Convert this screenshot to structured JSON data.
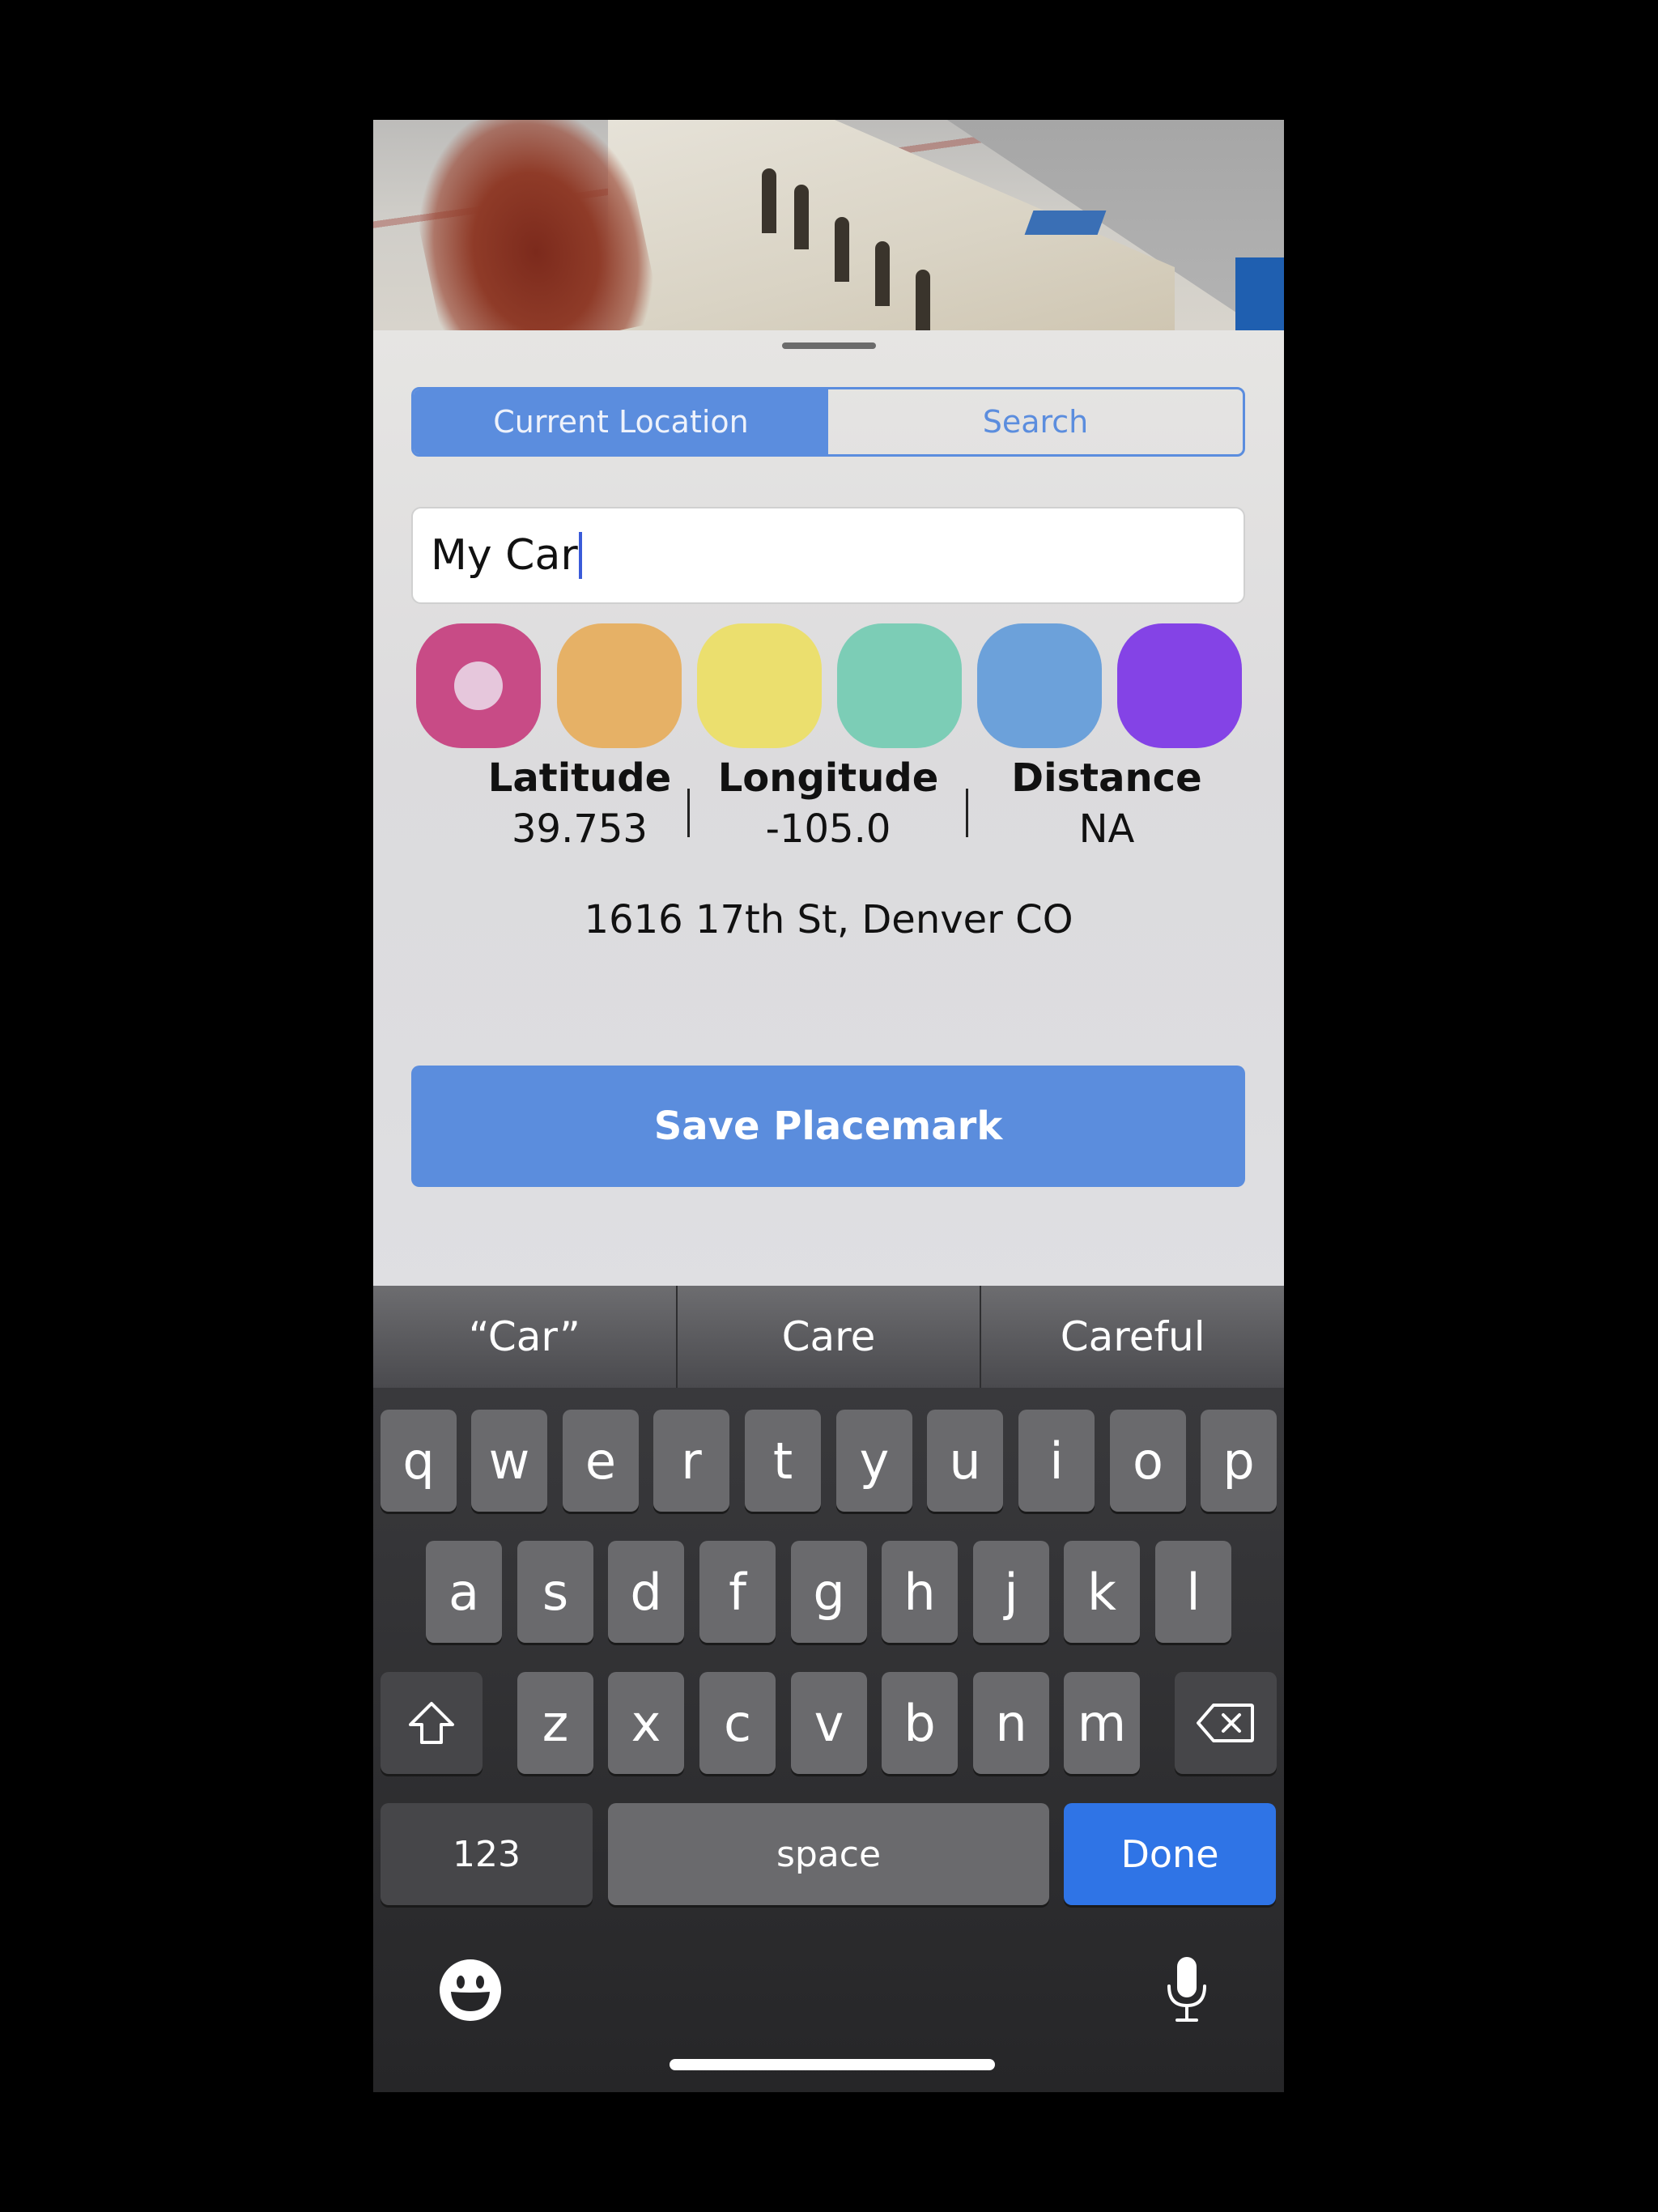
{
  "segmented": {
    "current_location": "Current Location",
    "search": "Search",
    "selected": "Current Location"
  },
  "name_field": {
    "value": "My Car"
  },
  "colors": [
    "#c84b86",
    "#e6b166",
    "#ebdf6e",
    "#7ccdb6",
    "#6ca1da",
    "#8443e6"
  ],
  "selected_color_index": 0,
  "stats": {
    "latitude": {
      "label": "Latitude",
      "value": "39.753"
    },
    "longitude": {
      "label": "Longitude",
      "value": "-105.0"
    },
    "distance": {
      "label": "Distance",
      "value": "NA"
    }
  },
  "address": "1616 17th St, Denver CO",
  "save_button": "Save Placemark",
  "keyboard": {
    "suggestions": [
      "“Car”",
      "Care",
      "Careful"
    ],
    "row1": [
      "q",
      "w",
      "e",
      "r",
      "t",
      "y",
      "u",
      "i",
      "o",
      "p"
    ],
    "row2": [
      "a",
      "s",
      "d",
      "f",
      "g",
      "h",
      "j",
      "k",
      "l"
    ],
    "row3": [
      "z",
      "x",
      "c",
      "v",
      "b",
      "n",
      "m"
    ],
    "numbers_key": "123",
    "space_key": "space",
    "done_key": "Done",
    "icons": {
      "shift": "shift-icon",
      "delete": "delete-icon",
      "emoji": "emoji-icon",
      "mic": "mic-icon"
    }
  },
  "accent_color": "#5b8dde"
}
